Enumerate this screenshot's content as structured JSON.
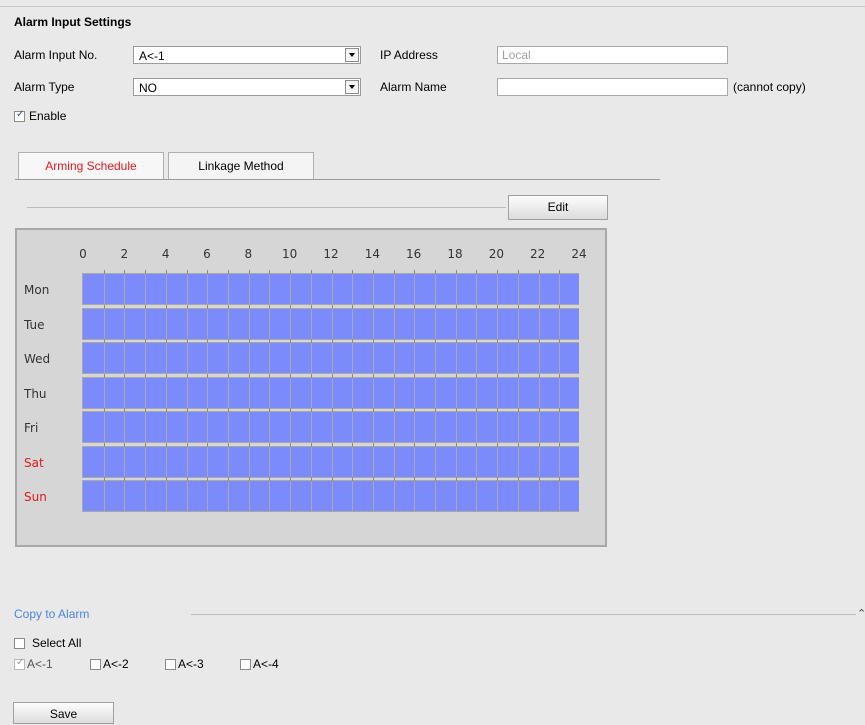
{
  "section": {
    "title": "Alarm Input Settings"
  },
  "form": {
    "alarm_input_no_label": "Alarm Input No.",
    "alarm_input_no_value": "A<-1",
    "ip_address_label": "IP Address",
    "ip_address_placeholder": "Local",
    "alarm_type_label": "Alarm Type",
    "alarm_type_value": "NO",
    "alarm_name_label": "Alarm Name",
    "alarm_name_value": "",
    "cannot_copy_note": "(cannot copy)",
    "enable_label": "Enable",
    "enable_checked": true
  },
  "tabs": [
    {
      "label": "Arming Schedule",
      "active": true
    },
    {
      "label": "Linkage Method",
      "active": false
    }
  ],
  "edit_button": "Edit",
  "schedule": {
    "hours": [
      "0",
      "2",
      "4",
      "6",
      "8",
      "10",
      "12",
      "14",
      "16",
      "18",
      "20",
      "22",
      "24"
    ],
    "days": [
      {
        "label": "Mon",
        "weekend": false
      },
      {
        "label": "Tue",
        "weekend": false
      },
      {
        "label": "Wed",
        "weekend": false
      },
      {
        "label": "Thu",
        "weekend": false
      },
      {
        "label": "Fri",
        "weekend": false
      },
      {
        "label": "Sat",
        "weekend": true
      },
      {
        "label": "Sun",
        "weekend": true
      }
    ],
    "fill_color": "#7b8bfb",
    "weekend_color": "#e0181b"
  },
  "copy": {
    "title": "Copy to Alarm",
    "select_all_label": "Select All",
    "alarms": [
      {
        "label": "A<-1",
        "checked": true,
        "disabled": true
      },
      {
        "label": "A<-2",
        "checked": false,
        "disabled": false
      },
      {
        "label": "A<-3",
        "checked": false,
        "disabled": false
      },
      {
        "label": "A<-4",
        "checked": false,
        "disabled": false
      }
    ]
  },
  "save_button": "Save",
  "colors": {
    "tab_active": "#e0181b",
    "link_blue": "#4a86d8",
    "background": "#e9e9e9"
  }
}
